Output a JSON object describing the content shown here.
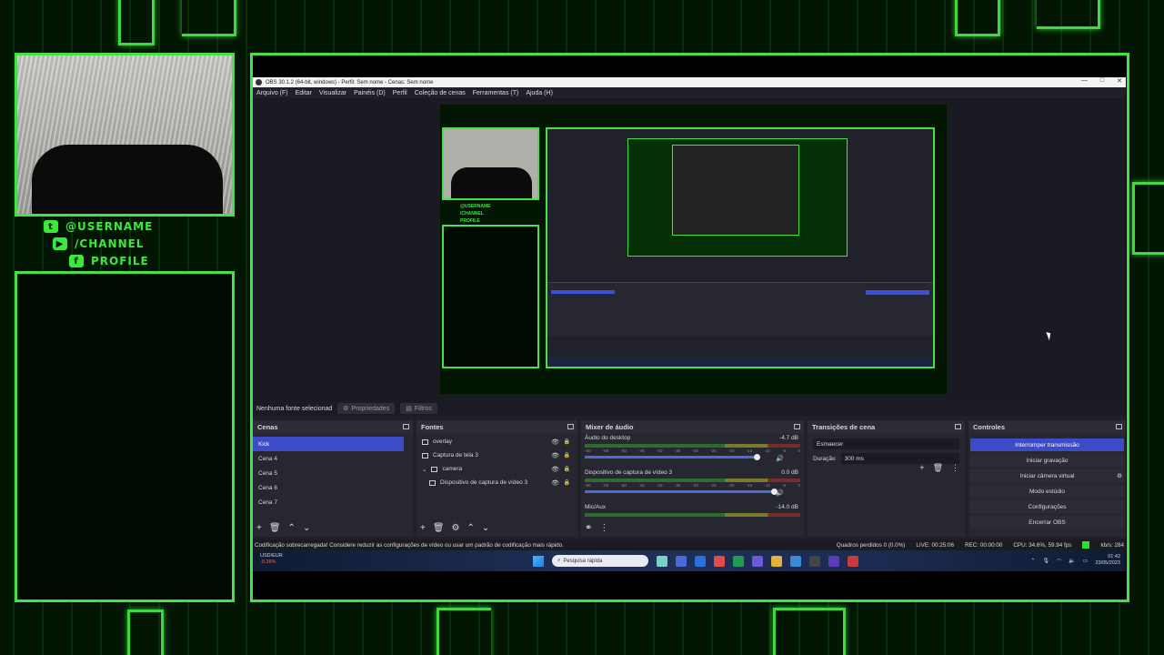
{
  "overlay": {
    "social": [
      {
        "icon": "twitter-icon",
        "label": "@USERNAME"
      },
      {
        "icon": "youtube-icon",
        "label": "/CHANNEL"
      },
      {
        "icon": "facebook-icon",
        "label": "PROFILE"
      }
    ],
    "accent": "#48e048"
  },
  "obs": {
    "title": "OBS 30.1.2 (64-bit, windows) - Perfil: Sem nome - Cenas: Sem nome",
    "menu": [
      "Arquivo (F)",
      "Editar",
      "Visualizar",
      "Painéis (D)",
      "Perfil",
      "Coleção de cenas",
      "Ferramentas (T)",
      "Ajuda (H)"
    ],
    "source_bar": {
      "no_source": "Nenhuma fonte selecionad",
      "properties": "Propriedades",
      "filters": "Filtros"
    },
    "scenes": {
      "title": "Cenas",
      "items": [
        "Kick",
        "Cena 4",
        "Cena 5",
        "Cena 6",
        "Cena 7"
      ],
      "active": "Kick"
    },
    "sources": {
      "title": "Fontes",
      "items": [
        "overlay",
        "Captura de tela 3",
        "camera",
        "Dispositivo de captura de vídeo 3"
      ]
    },
    "mixer": {
      "title": "Mixer de áudio",
      "channels": [
        {
          "name": "Áudio do desktop",
          "db": "-4.7 dB"
        },
        {
          "name": "Dispositivo de captura de vídeo 3",
          "db": "0.0 dB"
        },
        {
          "name": "Mic/Aux",
          "db": "-14.0 dB"
        }
      ],
      "ticks": [
        "-60",
        "-55",
        "-50",
        "-45",
        "-40",
        "-35",
        "-30",
        "-25",
        "-20",
        "-15",
        "-10",
        "-5",
        "0"
      ]
    },
    "transitions": {
      "title": "Transições de cena",
      "selected": "Esmaecer",
      "duration_label": "Duração",
      "duration_value": "300 ms"
    },
    "controls": {
      "title": "Controles",
      "buttons": [
        "Interromper transmissão",
        "Iniciar gravação",
        "Iniciar câmera virtual",
        "Modo estúdio",
        "Configurações",
        "Encerrar OBS"
      ]
    },
    "status": {
      "message": "Codificação sobrecarregada! Considere reduzir as configurações de vídeo ou usar um padrão de codificação mais rápido.",
      "dropped": "Quadros perdidos 0 (0.0%)",
      "live": "LIVE: 00:25:06",
      "rec": "REC: 00:00:00",
      "cpu": "CPU: 34.6%, 59.94 fps",
      "kbs": "kb/s: 284"
    }
  },
  "taskbar": {
    "weather_title": "USD/EUR",
    "weather_sub": "-0.26%",
    "search": "Pesquisa rápida",
    "time": "01:42",
    "date": "23/05/2023"
  }
}
